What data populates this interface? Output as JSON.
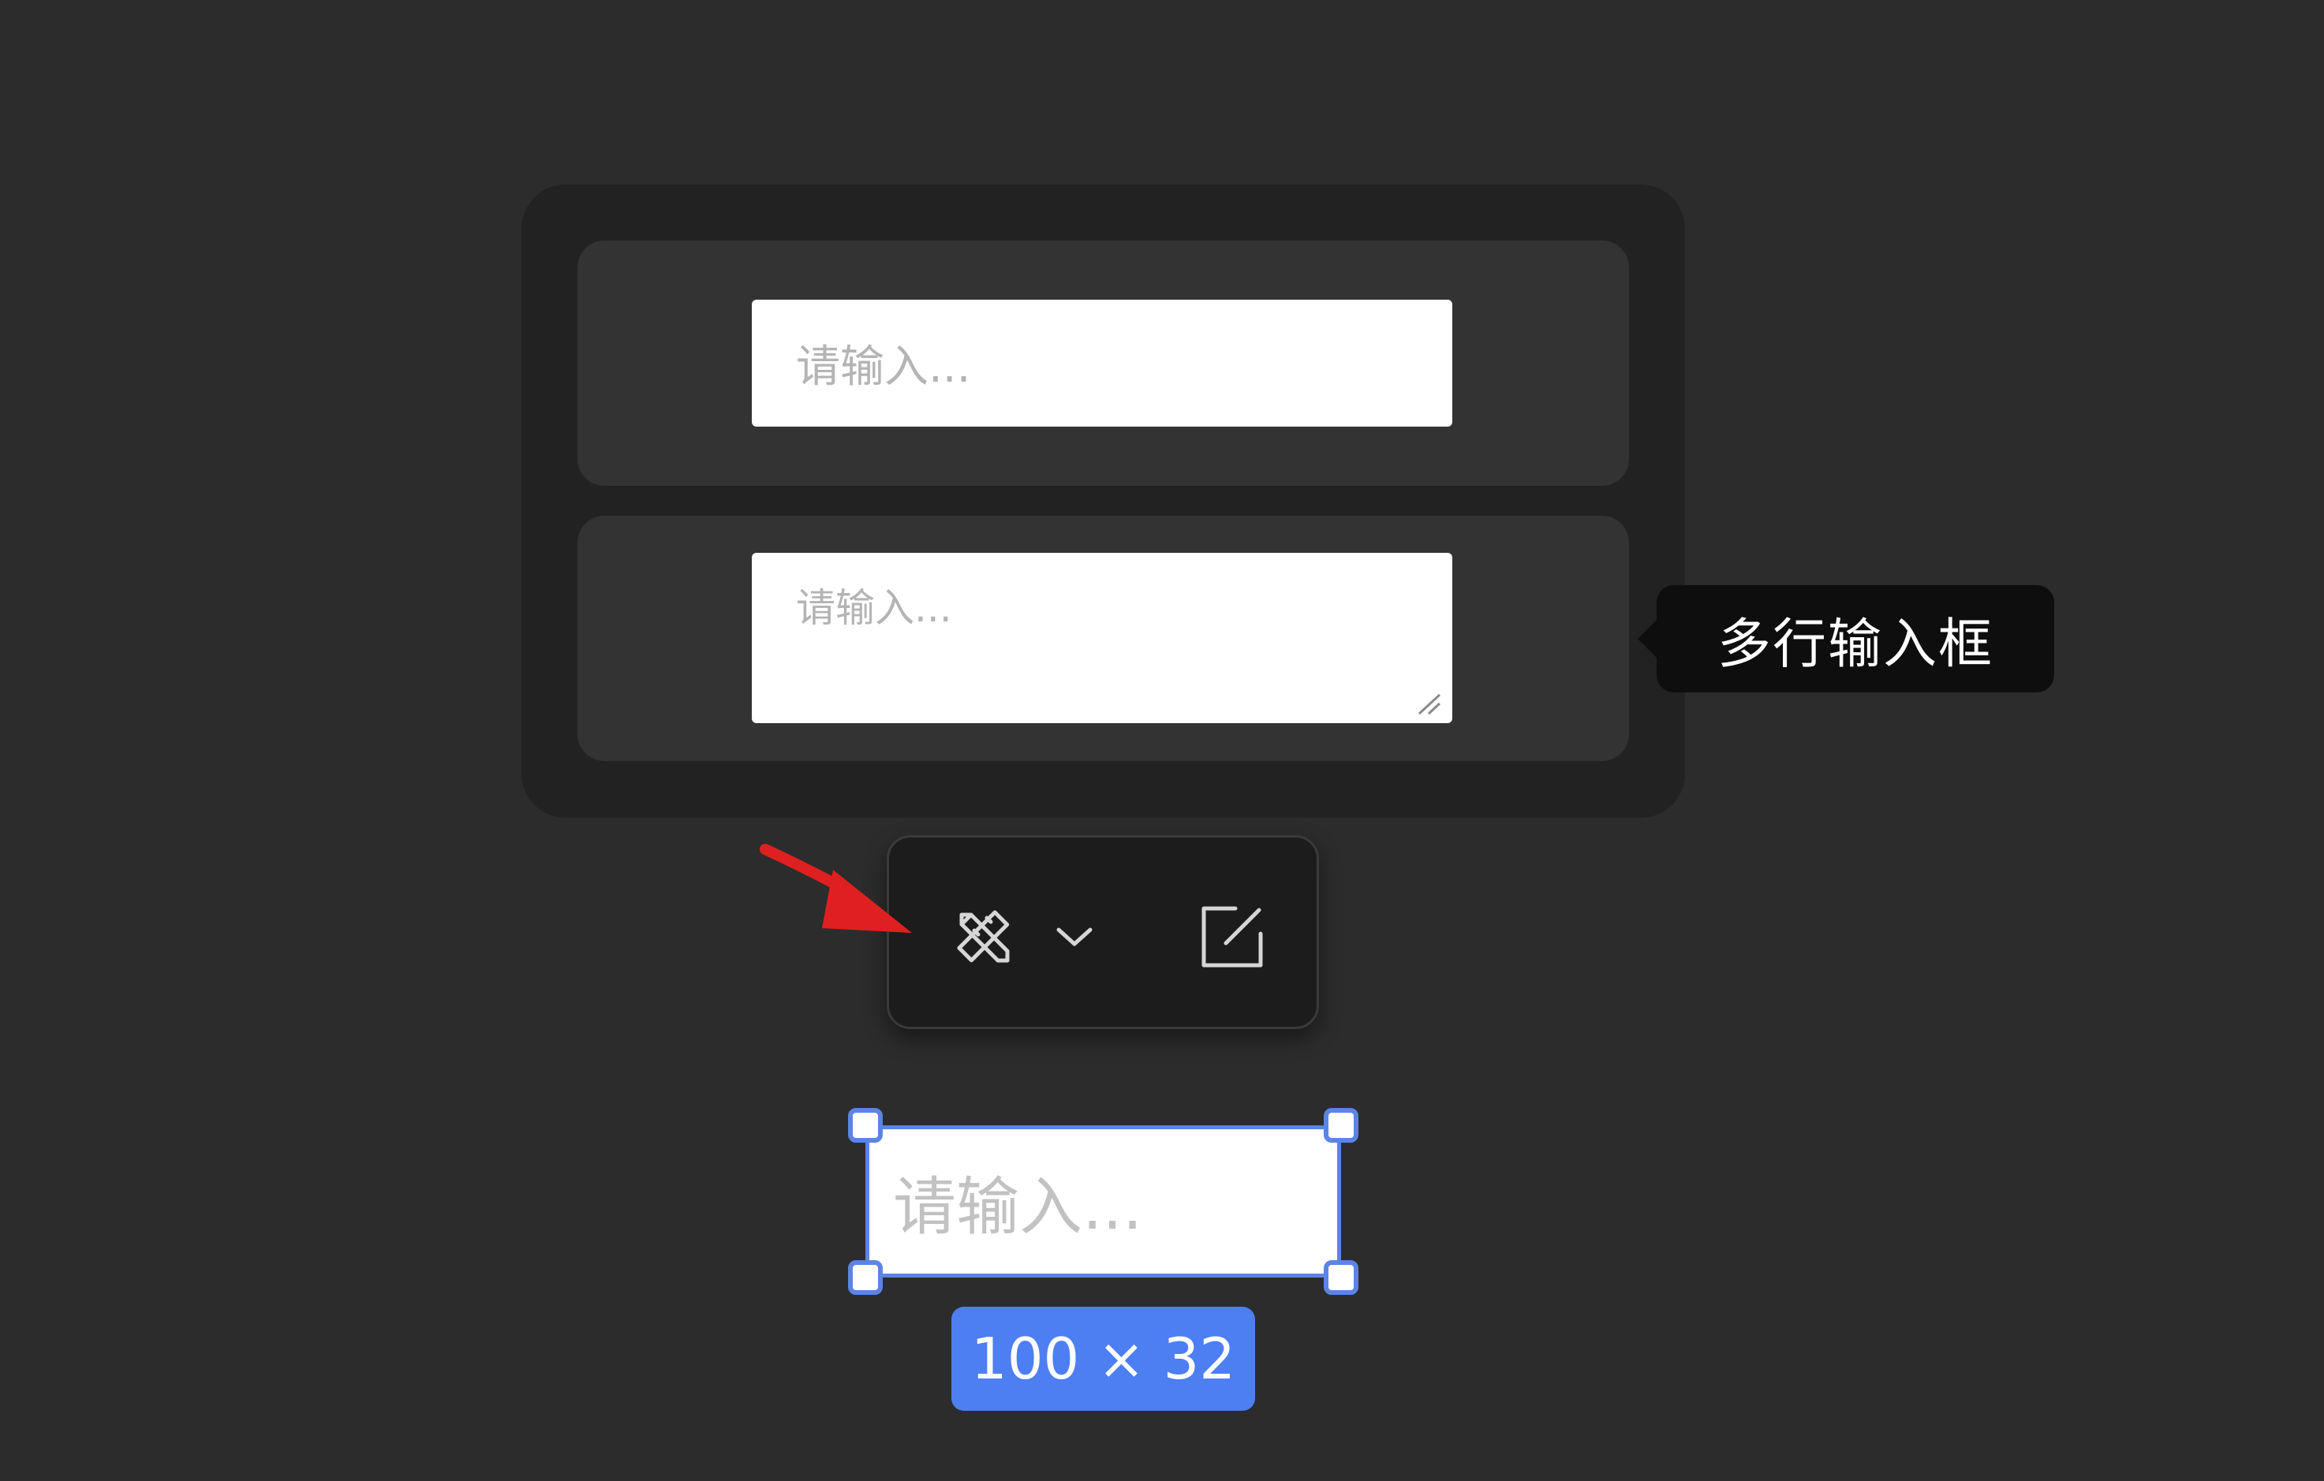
{
  "panel": {
    "single_input": {
      "placeholder": "请输入..."
    },
    "multi_input": {
      "placeholder": "请输入..."
    }
  },
  "tooltip": {
    "label": "多行输入框"
  },
  "toolbar": {
    "items": [
      {
        "icon": "design-tools-icon"
      },
      {
        "icon": "chevron-down-icon"
      },
      {
        "icon": "edit-icon"
      }
    ]
  },
  "annotation": {
    "arrow_color": "#e02020"
  },
  "selection": {
    "placeholder": "请输入...",
    "size_label": "100 × 32",
    "accent_color": "#5b84e6",
    "badge_color": "#4d7ff2"
  }
}
